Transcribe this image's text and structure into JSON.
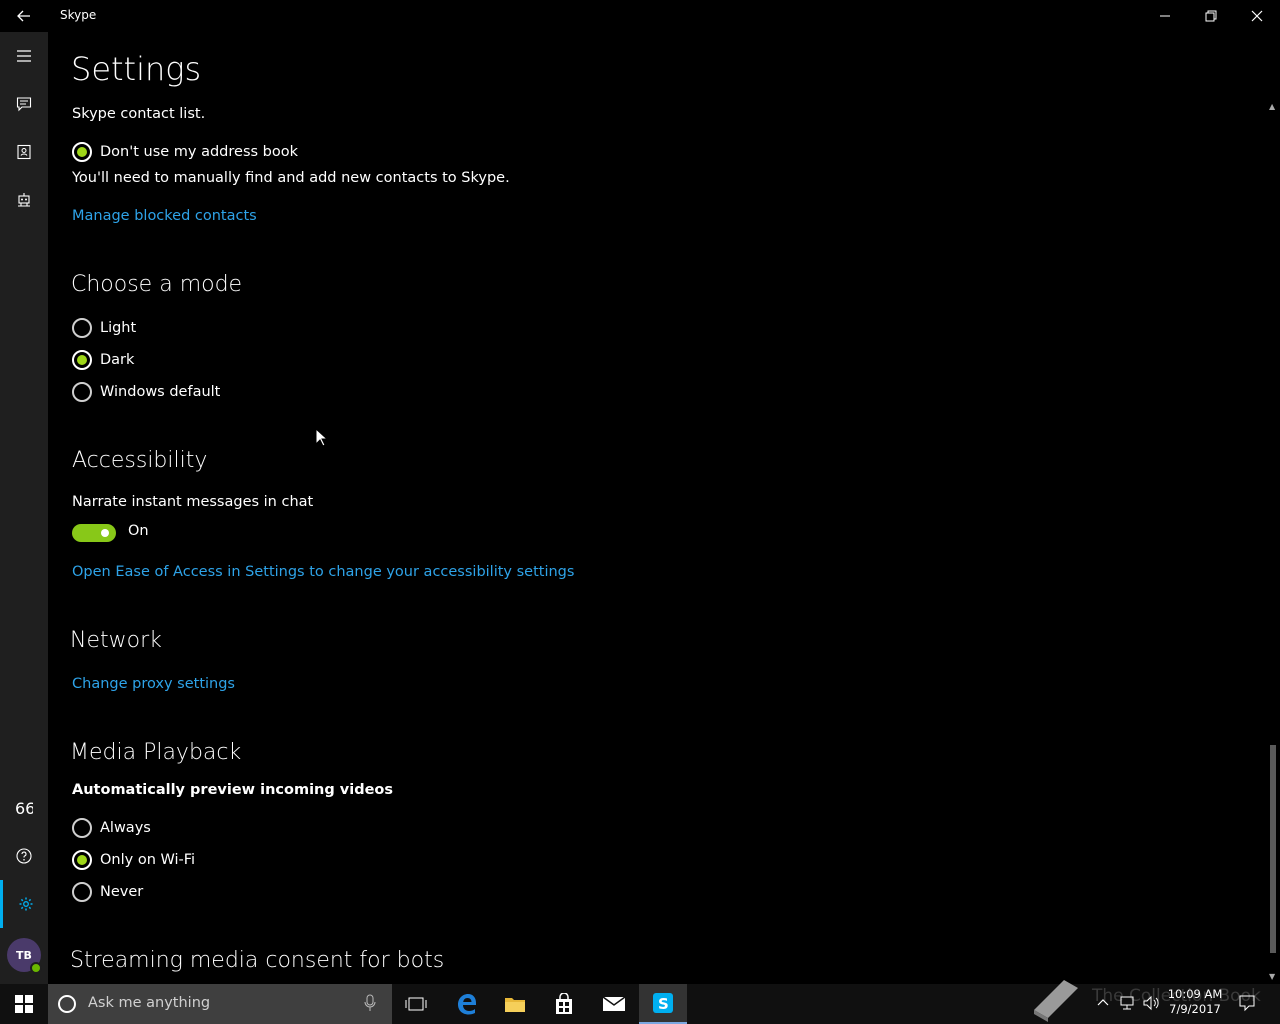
{
  "window": {
    "title": "Skype"
  },
  "page": {
    "title": "Settings"
  },
  "contacts": {
    "partial_line": "Skype contact list.",
    "option": "Don't use my address book",
    "option_desc": "You'll need to manually find and add new contacts to Skype.",
    "manage_link": "Manage blocked contacts"
  },
  "mode": {
    "heading": "Choose a mode",
    "options": [
      {
        "label": "Light",
        "checked": false
      },
      {
        "label": "Dark",
        "checked": true
      },
      {
        "label": "Windows default",
        "checked": false
      }
    ]
  },
  "accessibility": {
    "heading": "Accessibility",
    "narrate_label": "Narrate instant messages in chat",
    "toggle_state": "On",
    "ease_link": "Open Ease of Access in Settings to change your accessibility settings"
  },
  "network": {
    "heading": "Network",
    "proxy_link": "Change proxy settings"
  },
  "media": {
    "heading": "Media Playback",
    "subheading": "Automatically preview incoming videos",
    "options": [
      {
        "label": "Always",
        "checked": false
      },
      {
        "label": "Only on Wi-Fi",
        "checked": true
      },
      {
        "label": "Never",
        "checked": false
      }
    ]
  },
  "streaming": {
    "heading": "Streaming media consent for bots"
  },
  "user": {
    "initials": "TB"
  },
  "taskbar": {
    "search_placeholder": "Ask me anything",
    "watermark": "The Collection Book",
    "time": "10:09 AM",
    "date": "7/9/2017"
  },
  "colors": {
    "accent": "#00aff0",
    "radio_fill": "#9ed618",
    "toggle_on": "#88c818",
    "link": "#2ea3e8"
  }
}
